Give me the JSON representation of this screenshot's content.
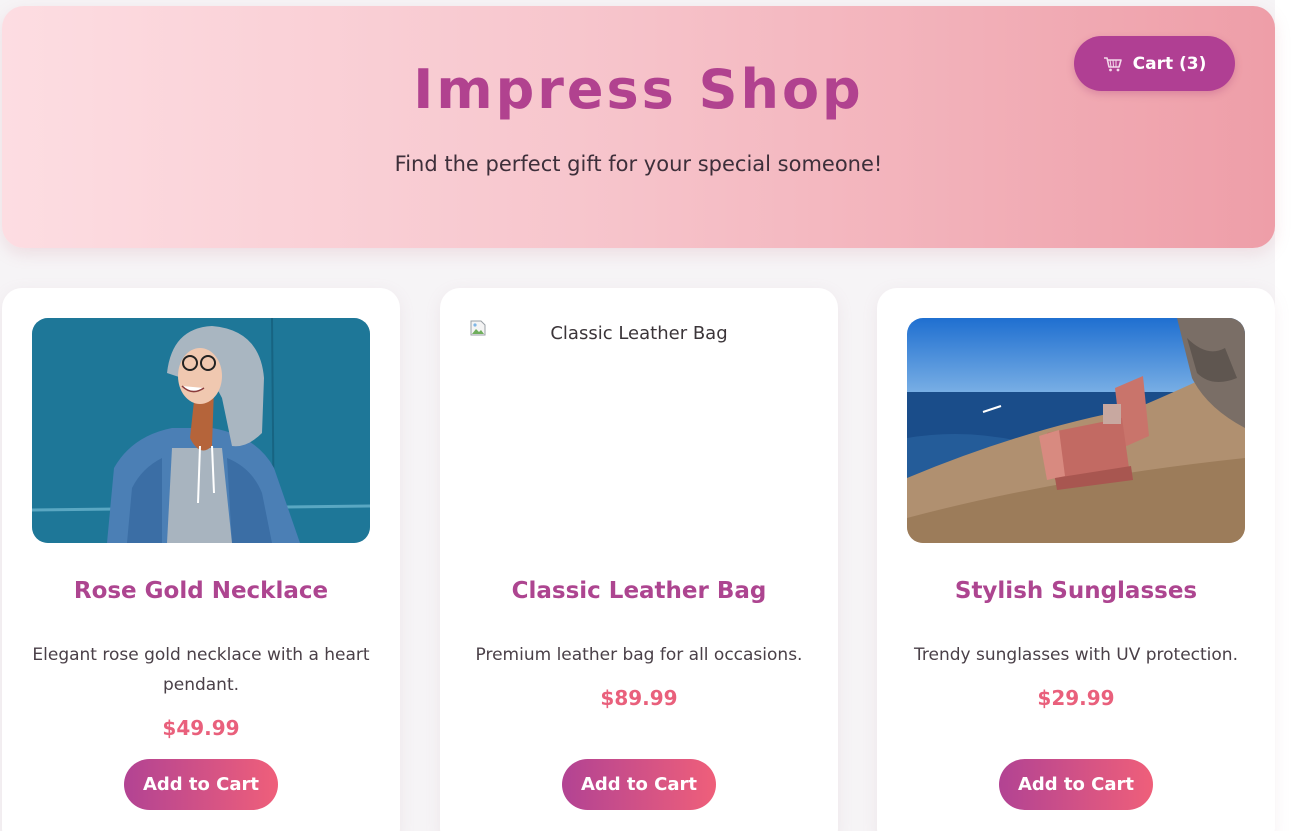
{
  "header": {
    "title": "Impress Shop",
    "tagline": "Find the perfect gift for your special someone!",
    "cart_label": "Cart (3)",
    "cart_icon": "shopping-cart-icon"
  },
  "colors": {
    "brand": "#b03f93",
    "price": "#e9607c",
    "header_gradient_start": "#fddde2",
    "header_gradient_end": "#ee9ea8"
  },
  "products": [
    {
      "name": "Rose Gold Necklace",
      "description": "Elegant rose gold necklace with a heart pendant.",
      "price": "$49.99",
      "button_label": "Add to Cart",
      "image": "photo-woman-in-denim-jacket"
    },
    {
      "name": "Classic Leather Bag",
      "description": "Premium leather bag for all occasions.",
      "price": "$89.99",
      "button_label": "Add to Cart",
      "image_alt": "Classic Leather Bag"
    },
    {
      "name": "Stylish Sunglasses",
      "description": "Trendy sunglasses with UV protection.",
      "price": "$29.99",
      "button_label": "Add to Cart",
      "image": "photo-armchair-on-seaside-rocks"
    }
  ]
}
